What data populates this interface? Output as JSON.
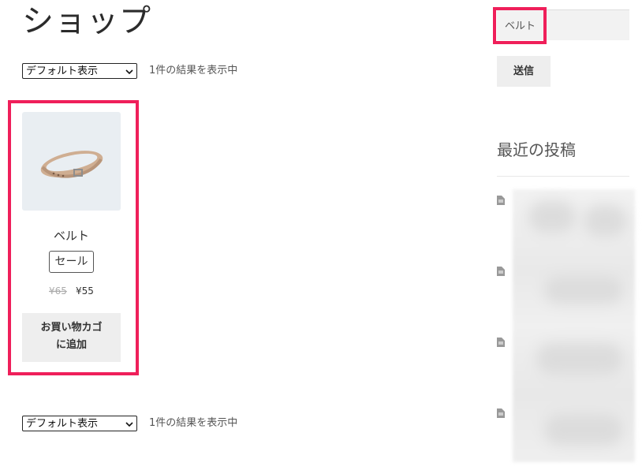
{
  "page": {
    "title": "ショップ"
  },
  "ordering": {
    "top": {
      "selected": "デフォルト表示"
    },
    "bottom": {
      "selected": "デフォルト表示"
    }
  },
  "result_count": "1件の結果を表示中",
  "product": {
    "name": "ベルト",
    "badge": "セール",
    "price_regular": "¥65",
    "price_sale": "¥55",
    "cart_button_line1": "お買い物カゴ",
    "cart_button_line2": "に追加"
  },
  "sidebar": {
    "search_value": "ベルト",
    "submit_label": "送信",
    "recent_posts_title": "最近の投稿",
    "recent_post_icon": "document-icon"
  },
  "colors": {
    "highlight": "#ef1f5a",
    "button_bg": "#eeeeee"
  }
}
